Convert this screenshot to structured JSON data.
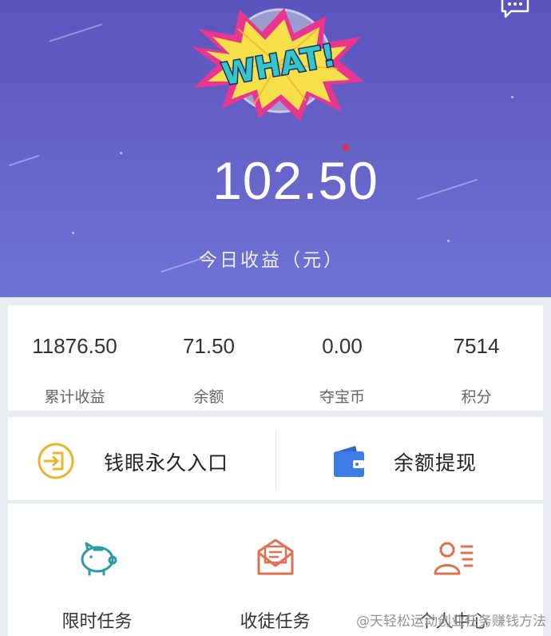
{
  "header": {
    "badge_text": "WHAT!",
    "amount": "102.50",
    "amount_label": "今日收益（元）",
    "icons": [
      "chat-icon"
    ]
  },
  "stats": [
    {
      "value": "11876.50",
      "label": "累计收益"
    },
    {
      "value": "71.50",
      "label": "余额"
    },
    {
      "value": "0.00",
      "label": "夺宝币"
    },
    {
      "value": "7514",
      "label": "积分"
    }
  ],
  "actions": [
    {
      "label": "钱眼永久入口",
      "icon": "enter-icon"
    },
    {
      "label": "余额提现",
      "icon": "wallet-icon"
    }
  ],
  "menu": [
    {
      "label": "限时任务",
      "icon": "piggy-bank-icon"
    },
    {
      "label": "收徒任务",
      "icon": "envelope-icon"
    },
    {
      "label": "个人中心",
      "icon": "profile-card-icon"
    }
  ],
  "watermark": "@天轻松运动创业任务赚钱方法",
  "colors": {
    "header_top": "#5b54bd",
    "header_bottom": "#6e73d6",
    "accent_yellow": "#e9b52a",
    "accent_blue": "#3d7de3",
    "accent_teal": "#2a9aa6",
    "accent_orange": "#e0704f"
  }
}
